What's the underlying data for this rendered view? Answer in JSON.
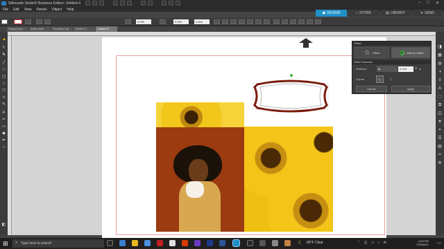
{
  "window": {
    "title": "Silhouette Studio® Business Edition: Untitled-4"
  },
  "menu": [
    "File",
    "Edit",
    "View",
    "Panels",
    "Object",
    "Help"
  ],
  "nav": {
    "design": "DESIGN",
    "store": "STORE",
    "library": "LIBRARY",
    "send": "SEND"
  },
  "toolbar": {
    "width": "0.000",
    "height": "0.000",
    "x": "0.000",
    "y": "0.000"
  },
  "doc_tabs": [
    "Shaped box",
    "Adult order",
    "Grosvilla Tag",
    "Untitled-1",
    "Untitled-2"
  ],
  "offset_panel": {
    "title": "Offset",
    "offset_label": "Offset",
    "internal_label": "Internal Offset",
    "section": "Offset Distance",
    "distance_label": "Distance",
    "distance_value": "0.125",
    "unit": "in",
    "corner_label": "Corner",
    "cancel": "Cancel",
    "apply": "Apply"
  },
  "taskbar": {
    "search_placeholder": "Type here to search",
    "weather": "65°F Clear",
    "time": "4:29 PM",
    "date": "7/20/2021"
  },
  "colors": {
    "accent": "#1e90c8",
    "panel_bg": "#3c3c3c",
    "canvas_bg": "#d4d4d4"
  }
}
